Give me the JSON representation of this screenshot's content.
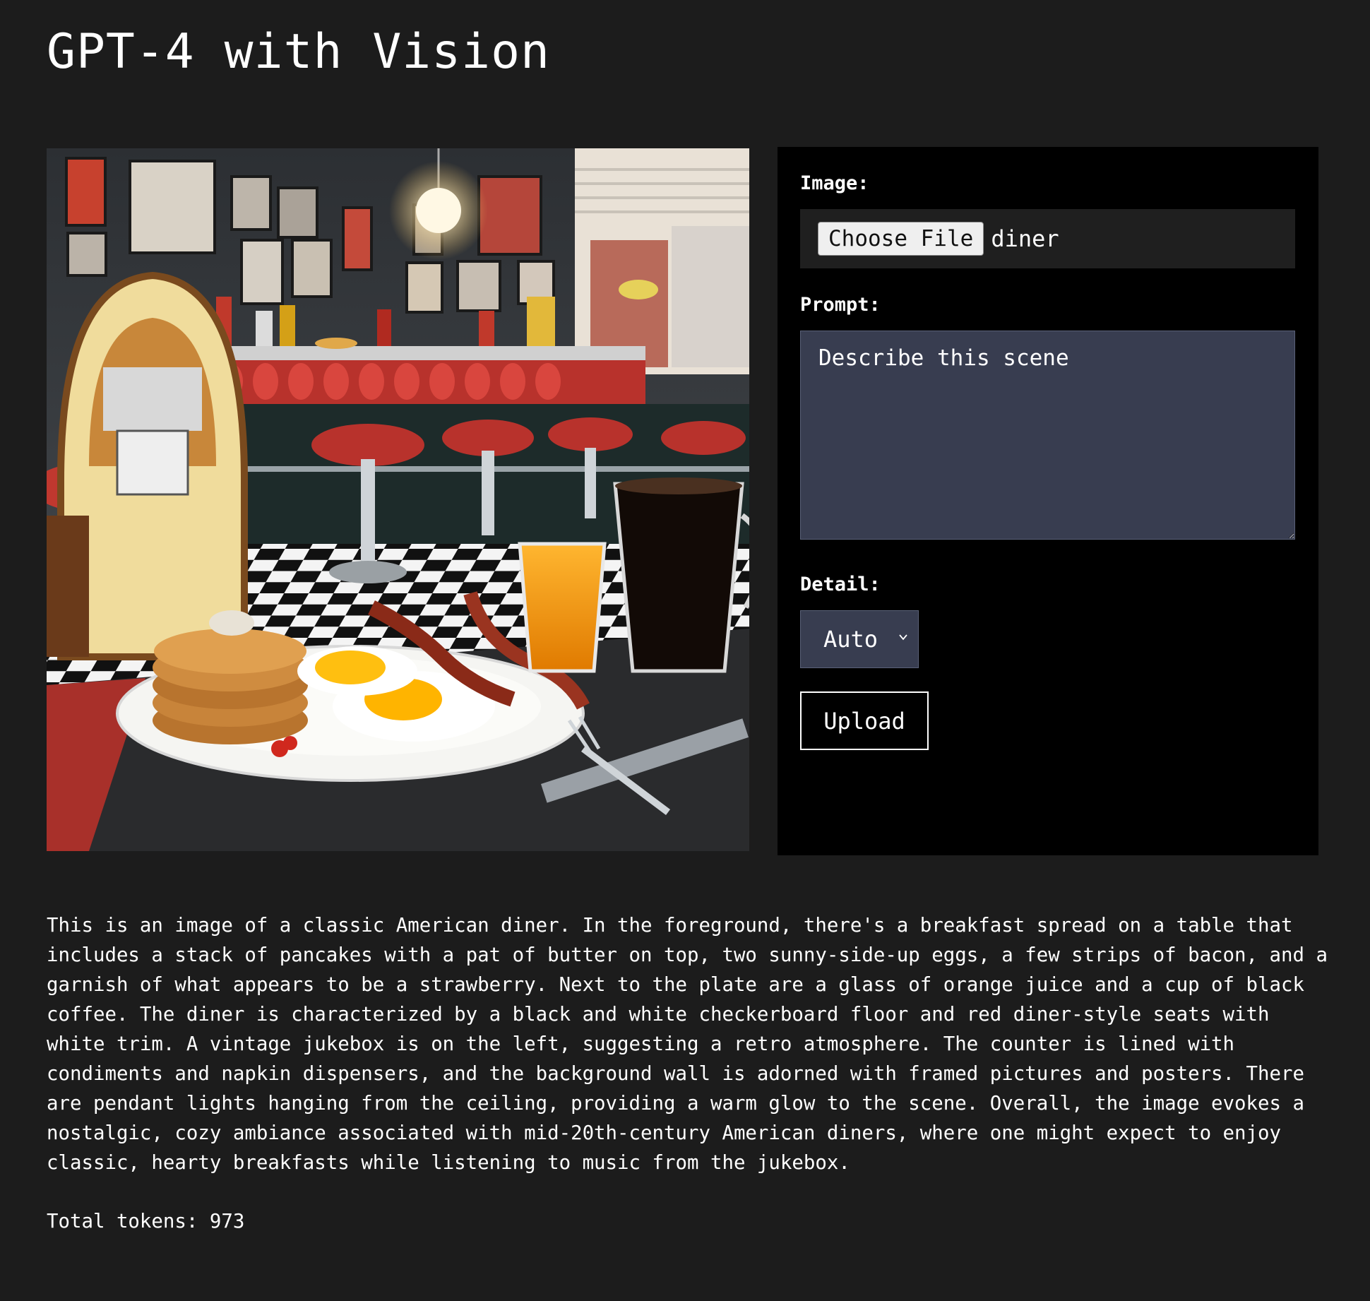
{
  "header": {
    "title": "GPT-4 with Vision"
  },
  "preview": {
    "alt": "Generated image of a retro American diner with a breakfast plate, orange juice and coffee"
  },
  "form": {
    "image_label": "Image:",
    "choose_file_label": "Choose File",
    "file_name": "diner",
    "prompt_label": "Prompt:",
    "prompt_value": "Describe this scene",
    "detail_label": "Detail:",
    "detail_value": "Auto",
    "upload_label": "Upload"
  },
  "result": {
    "description": "This is an image of a classic American diner. In the foreground, there's a breakfast spread on a table that includes a stack of pancakes with a pat of butter on top, two sunny-side-up eggs, a few strips of bacon, and a garnish of what appears to be a strawberry. Next to the plate are a glass of orange juice and a cup of black coffee. The diner is characterized by a black and white checkerboard floor and red diner-style seats with white trim. A vintage jukebox is on the left, suggesting a retro atmosphere. The counter is lined with condiments and napkin dispensers, and the background wall is adorned with framed pictures and posters. There are pendant lights hanging from the ceiling, providing a warm glow to the scene. Overall, the image evokes a nostalgic, cozy ambiance associated with mid-20th-century American diners, where one might expect to enjoy classic, hearty breakfasts while listening to music from the jukebox.",
    "total_tokens_label": "Total tokens: 973"
  }
}
